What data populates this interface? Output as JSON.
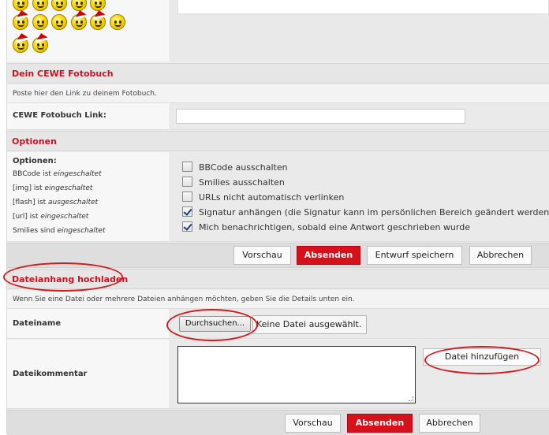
{
  "smilies": {
    "rows": [
      [
        "smiley-sad-santa",
        "smiley-grin-santa",
        "smiley-laugh-santa",
        "smiley-wink-santa",
        "smiley-happy-santa"
      ],
      [
        "smiley-shock-santa",
        "smiley-smile",
        "smiley-thumbsup",
        "smiley-teeth-santa",
        "smiley-thumbsdown-santa",
        "smiley-frown"
      ],
      [
        "smiley-love-santa",
        "smiley-cool-santa"
      ]
    ]
  },
  "cewe": {
    "header": "Dein CEWE Fotobuch",
    "note": "Poste hier den Link zu deinem Fotobuch.",
    "link_label": "CEWE Fotobuch Link:",
    "link_value": ""
  },
  "options": {
    "header": "Optionen",
    "label": "Optionen:",
    "status": [
      {
        "name": "BBCode",
        "text": "ist",
        "state": "eingeschaltet"
      },
      {
        "name": "[img]",
        "text": "ist",
        "state": "eingeschaltet"
      },
      {
        "name": "[flash]",
        "text": "ist",
        "state": "ausgeschaltet"
      },
      {
        "name": "[url]",
        "text": "ist",
        "state": "eingeschaltet"
      },
      {
        "name": "Smilies",
        "text": "sind",
        "state": "eingeschaltet"
      }
    ],
    "checkboxes": [
      {
        "label": "BBCode ausschalten",
        "checked": false
      },
      {
        "label": "Smilies ausschalten",
        "checked": false
      },
      {
        "label": "URLs nicht automatisch verlinken",
        "checked": false
      },
      {
        "label": "Signatur anhängen (die Signatur kann im persönlichen Bereich geändert werden)",
        "checked": true
      },
      {
        "label": "Mich benachrichtigen, sobald eine Antwort geschrieben wurde",
        "checked": true
      }
    ]
  },
  "buttons_top": {
    "preview": "Vorschau",
    "submit": "Absenden",
    "draft": "Entwurf speichern",
    "cancel": "Abbrechen"
  },
  "attachment": {
    "header": "Dateianhang hochladen",
    "note": "Wenn Sie eine Datei oder mehrere Dateien anhängen möchten, geben Sie die Details unten ein.",
    "filename_label": "Dateiname",
    "browse_label": "Durchsuchen...",
    "no_file": "Keine Datei ausgewählt.",
    "comment_label": "Dateikommentar",
    "comment_value": "",
    "add_file": "Datei hinzufügen"
  },
  "buttons_bottom": {
    "preview": "Vorschau",
    "submit": "Absenden",
    "cancel": "Abbrechen"
  },
  "colors": {
    "accent": "#cc1122",
    "primary_button": "#d7111c",
    "annotation": "#d4181f"
  }
}
